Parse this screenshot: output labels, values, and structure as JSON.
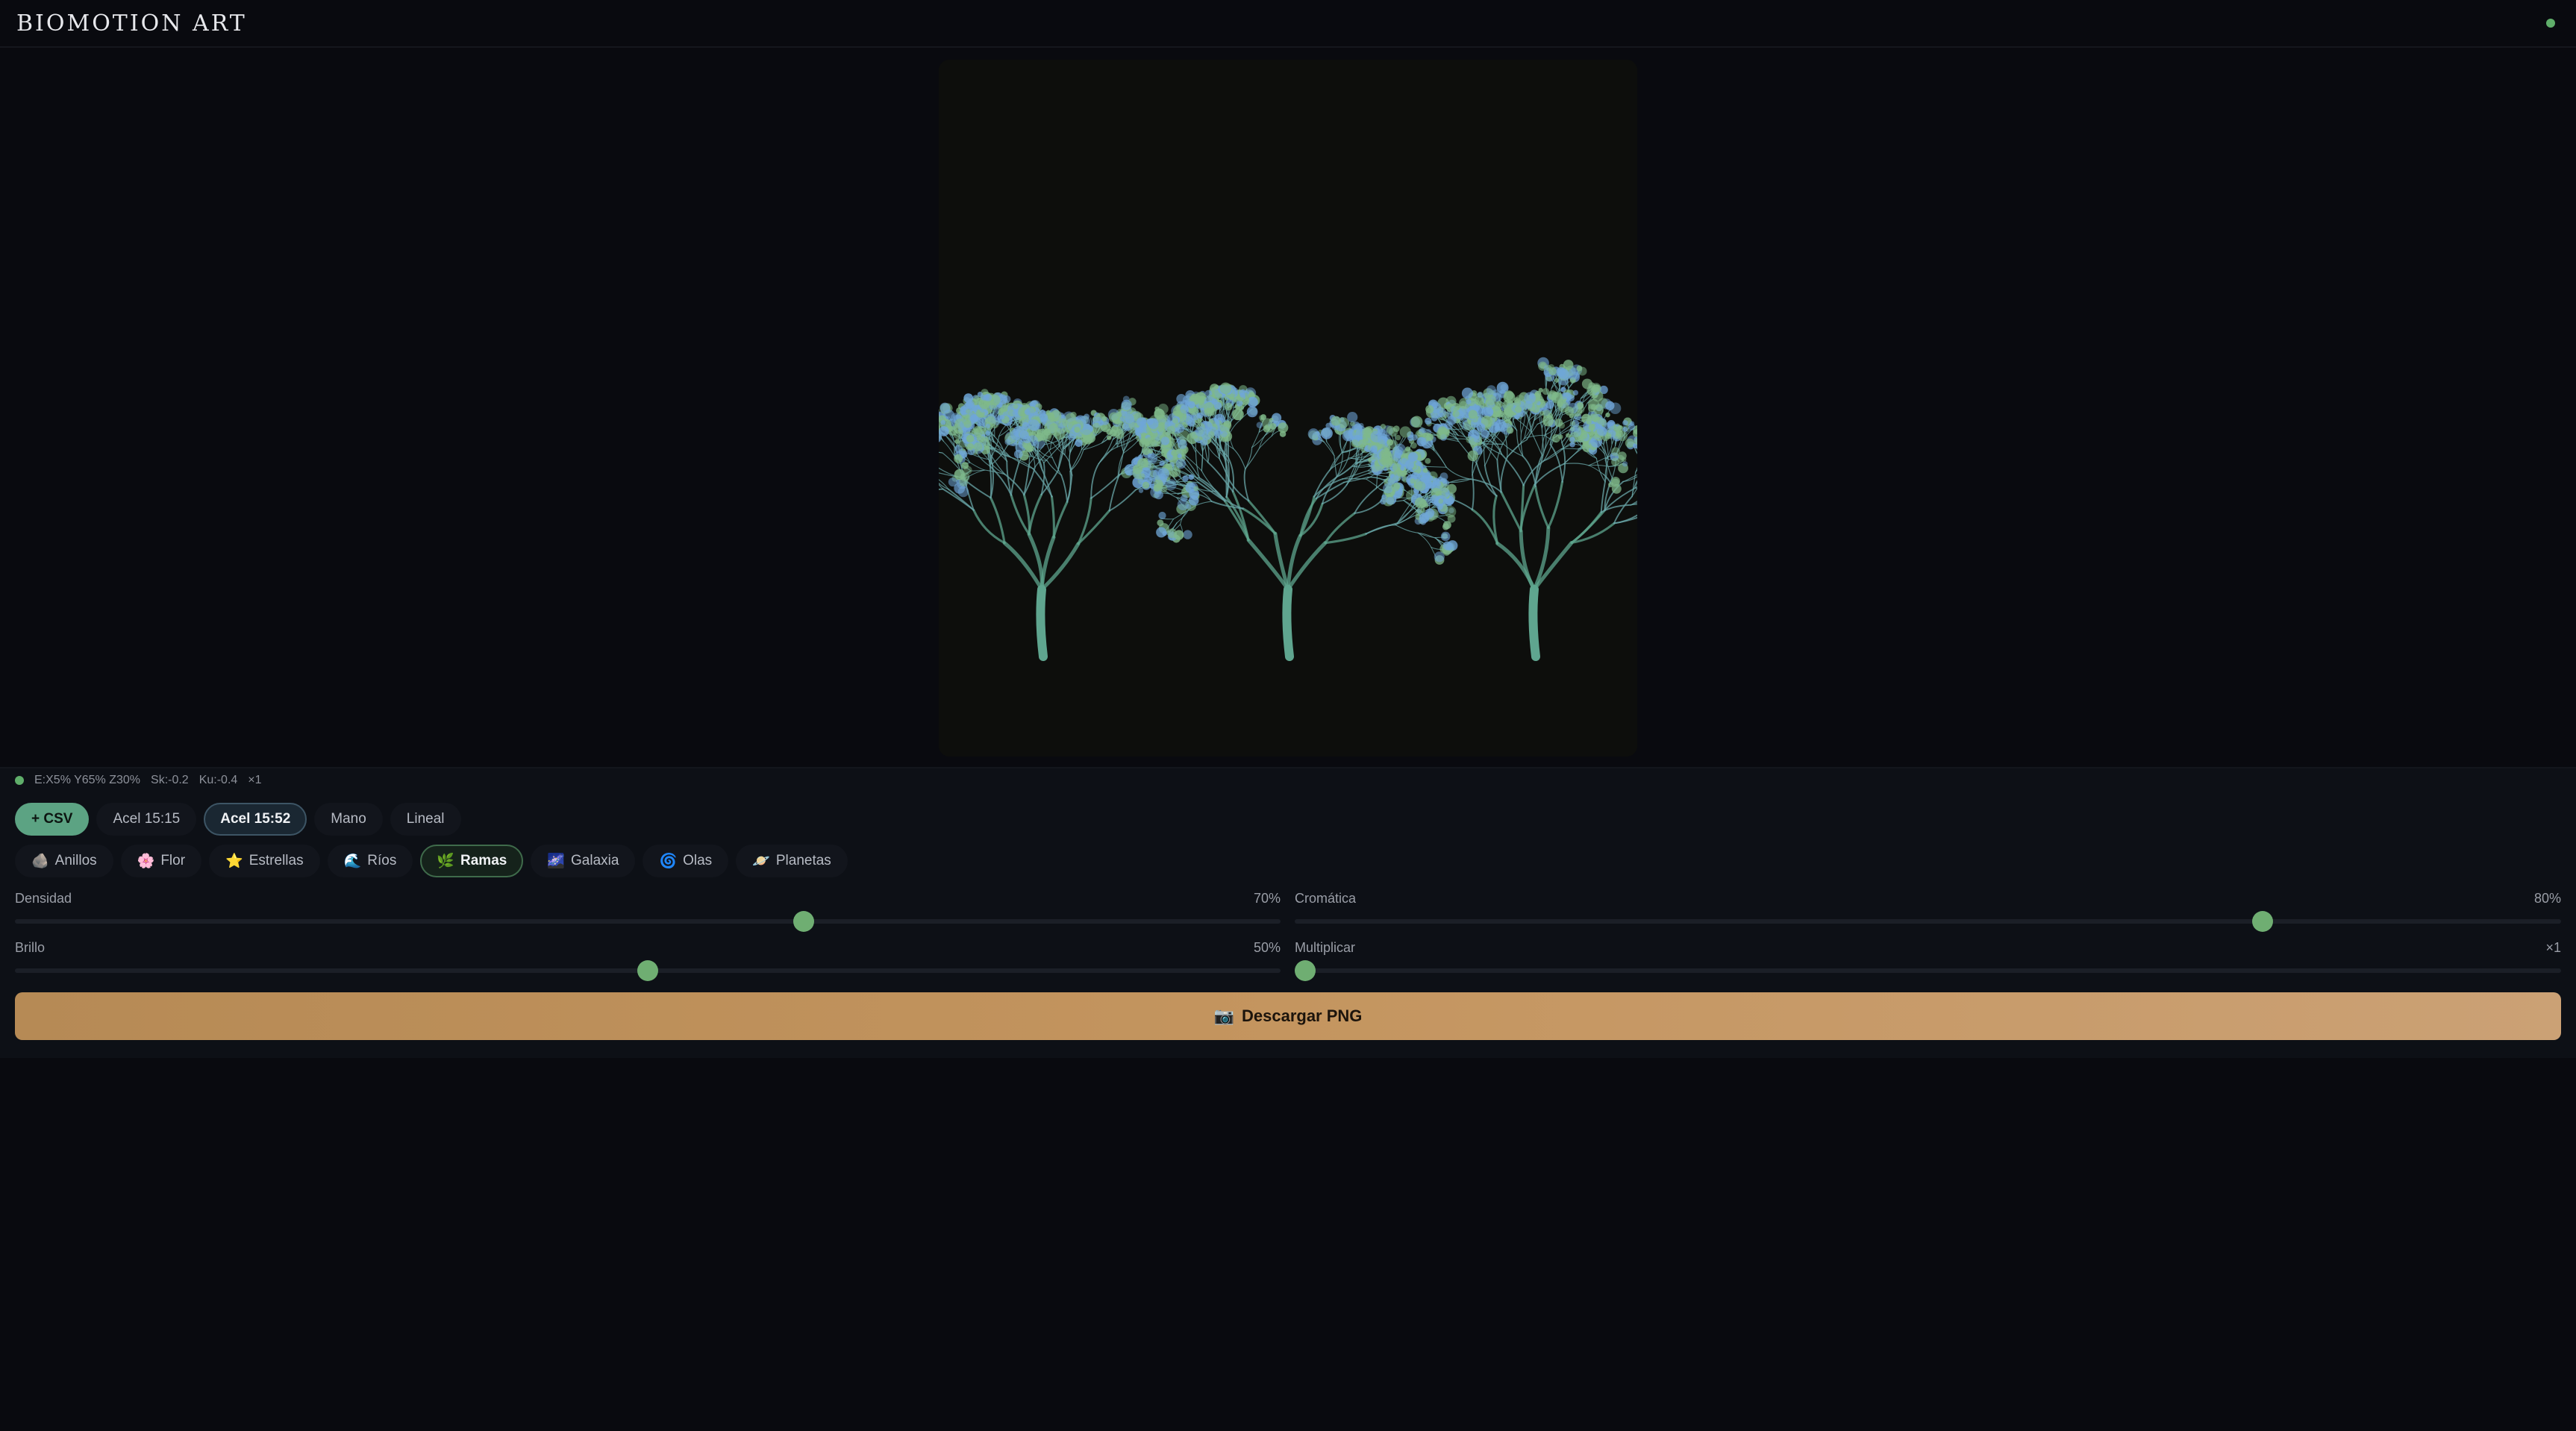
{
  "app": {
    "title": "BIOMOTION ART",
    "status_color": "#5fae6a"
  },
  "stats": {
    "energy": "E:X5% Y65% Z30%",
    "skew": "Sk:-0.2",
    "kurtosis": "Ku:-0.4",
    "multiplier": "×1"
  },
  "sources": [
    {
      "label": "+ CSV",
      "state": "primary"
    },
    {
      "label": "Acel 15:15",
      "state": "normal"
    },
    {
      "label": "Acel 15:52",
      "state": "selected"
    },
    {
      "label": "Mano",
      "state": "normal"
    },
    {
      "label": "Lineal",
      "state": "normal"
    }
  ],
  "modes": [
    {
      "icon": "🪨",
      "icon_name": "rock-icon",
      "label": "Anillos"
    },
    {
      "icon": "🌸",
      "icon_name": "flower-icon",
      "label": "Flor"
    },
    {
      "icon": "⭐",
      "icon_name": "star-icon",
      "label": "Estrellas"
    },
    {
      "icon": "🌊",
      "icon_name": "wave-icon",
      "label": "Ríos"
    },
    {
      "icon": "🌿",
      "icon_name": "herb-icon",
      "label": "Ramas",
      "selected": true
    },
    {
      "icon": "🌌",
      "icon_name": "galaxy-icon",
      "label": "Galaxia"
    },
    {
      "icon": "🌀",
      "icon_name": "spiral-icon",
      "label": "Olas"
    },
    {
      "icon": "🪐",
      "icon_name": "planet-icon",
      "label": "Planetas"
    }
  ],
  "sliders": {
    "density": {
      "label": "Densidad",
      "value_text": "70%",
      "fraction": 0.623
    },
    "chromatic": {
      "label": "Cromática",
      "value_text": "80%",
      "fraction": 0.764
    },
    "brightness": {
      "label": "Brillo",
      "value_text": "50%",
      "fraction": 0.5
    },
    "multiply": {
      "label": "Multiplicar",
      "value_text": "×1",
      "fraction": 0.008
    }
  },
  "download": {
    "icon": "📷",
    "icon_name": "camera-icon",
    "label": "Descargar PNG"
  },
  "colors": {
    "accent_green": "#5ca383",
    "slider_thumb": "#6fae72",
    "download_bg": "#c4955f",
    "background": "#090a0f"
  }
}
